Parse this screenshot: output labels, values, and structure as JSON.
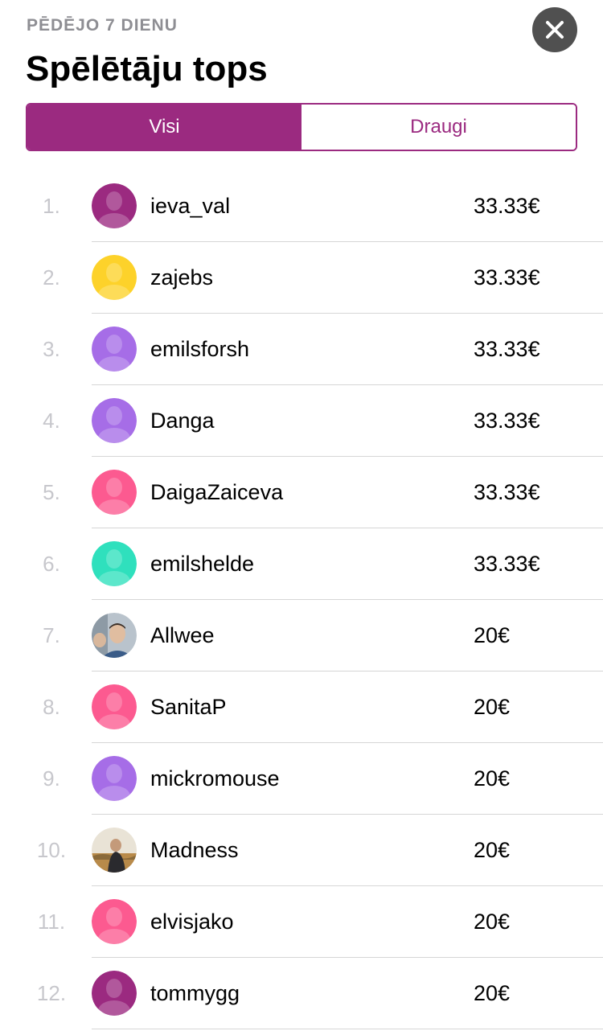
{
  "header": {
    "subtitle": "PĒDĒJO 7 DIENU",
    "title": "Spēlētāju tops"
  },
  "tabs": [
    {
      "label": "Visi",
      "active": true
    },
    {
      "label": "Draugi",
      "active": false
    }
  ],
  "leaderboard": [
    {
      "rank": "1.",
      "name": "ieva_val",
      "amount": "33.33€",
      "avatar": "default",
      "color": "#9b2a80"
    },
    {
      "rank": "2.",
      "name": "zajebs",
      "amount": "33.33€",
      "avatar": "default",
      "color": "#fdd22a"
    },
    {
      "rank": "3.",
      "name": "emilsforsh",
      "amount": "33.33€",
      "avatar": "default",
      "color": "#a66de7"
    },
    {
      "rank": "4.",
      "name": "Danga",
      "amount": "33.33€",
      "avatar": "default",
      "color": "#a66de7"
    },
    {
      "rank": "5.",
      "name": "DaigaZaiceva",
      "amount": "33.33€",
      "avatar": "default",
      "color": "#fc5a90"
    },
    {
      "rank": "6.",
      "name": "emilshelde",
      "amount": "33.33€",
      "avatar": "default",
      "color": "#2fe0bd"
    },
    {
      "rank": "7.",
      "name": "Allwee",
      "amount": "20€",
      "avatar": "photo-man",
      "color": "#7a8fa6"
    },
    {
      "rank": "8.",
      "name": "SanitaP",
      "amount": "20€",
      "avatar": "default",
      "color": "#fc5a90"
    },
    {
      "rank": "9.",
      "name": "mickromouse",
      "amount": "20€",
      "avatar": "default",
      "color": "#a66de7"
    },
    {
      "rank": "10.",
      "name": "Madness",
      "amount": "20€",
      "avatar": "photo-landscape",
      "color": "#c9a56a"
    },
    {
      "rank": "11.",
      "name": "elvisjako",
      "amount": "20€",
      "avatar": "default",
      "color": "#fc5a90"
    },
    {
      "rank": "12.",
      "name": "tommygg",
      "amount": "20€",
      "avatar": "default",
      "color": "#9b2a80"
    }
  ],
  "colors": {
    "accent": "#9b2a80",
    "close_button": "#505050",
    "rank_text": "#c7c7cc",
    "subtitle_text": "#8e8e93"
  },
  "icons": {
    "close": "close-icon",
    "avatar_placeholder": "person-silhouette-icon"
  }
}
